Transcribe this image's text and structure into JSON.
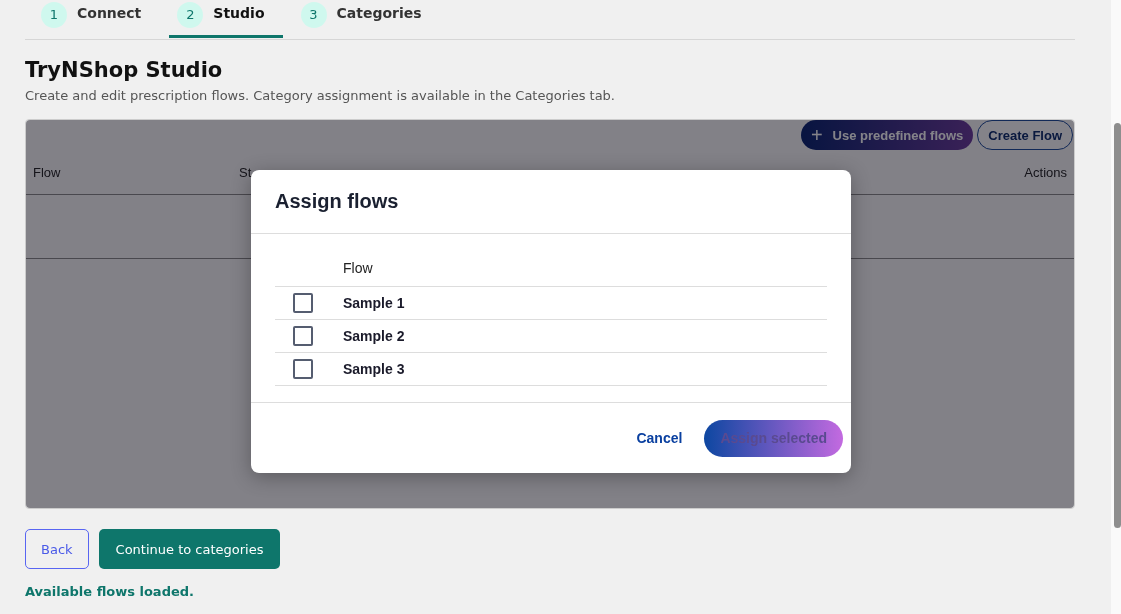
{
  "steps": [
    {
      "number": "1",
      "label": "Connect",
      "selected": false
    },
    {
      "number": "2",
      "label": "Studio",
      "selected": true
    },
    {
      "number": "3",
      "label": "Categories",
      "selected": false
    }
  ],
  "title": "TryNShop Studio",
  "description": "Create and edit prescription flows. Category assignment is available in the Categories tab.",
  "toolbar": {
    "predefined_button": "Use predefined flows",
    "plus_icon": "+",
    "create_button": "Create Flow"
  },
  "table": {
    "columns": [
      "Flow",
      "St",
      "Actions"
    ]
  },
  "modal": {
    "title": "Assign flows",
    "column": "Flow",
    "rows": [
      {
        "name": "Sample 1",
        "checked": false
      },
      {
        "name": "Sample 2",
        "checked": false
      },
      {
        "name": "Sample 3",
        "checked": false
      }
    ],
    "cancel": "Cancel",
    "assign": "Assign selected"
  },
  "buttons": {
    "back": "Back",
    "continue": "Continue to categories"
  },
  "status": "Available flows loaded."
}
